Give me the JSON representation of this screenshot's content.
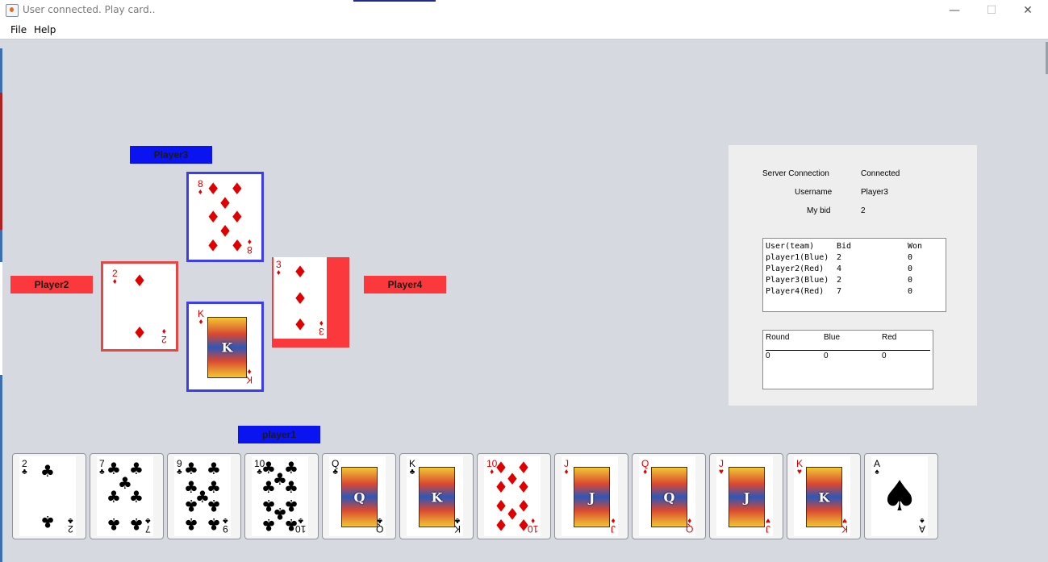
{
  "window": {
    "title": "User connected. Play card..",
    "minimize": "—",
    "maximize": "☐",
    "close": "✕"
  },
  "menu": [
    "File",
    "Help"
  ],
  "players": {
    "top": "Player3",
    "left": "Player2",
    "right": "Player4",
    "bottom": "player1"
  },
  "table_cards": {
    "top": {
      "rank": "8",
      "suit": "♦",
      "color": "red"
    },
    "left": {
      "rank": "2",
      "suit": "♦",
      "color": "red"
    },
    "right": {
      "rank": "3",
      "suit": "♦",
      "color": "red"
    },
    "bottom": {
      "rank": "K",
      "suit": "♦",
      "color": "red"
    }
  },
  "hand": [
    {
      "rank": "2",
      "suit": "♣",
      "color": "black"
    },
    {
      "rank": "7",
      "suit": "♣",
      "color": "black"
    },
    {
      "rank": "9",
      "suit": "♣",
      "color": "black"
    },
    {
      "rank": "10",
      "suit": "♣",
      "color": "black"
    },
    {
      "rank": "Q",
      "suit": "♣",
      "color": "black"
    },
    {
      "rank": "K",
      "suit": "♣",
      "color": "black"
    },
    {
      "rank": "10",
      "suit": "♦",
      "color": "red"
    },
    {
      "rank": "J",
      "suit": "♦",
      "color": "red"
    },
    {
      "rank": "Q",
      "suit": "♦",
      "color": "red"
    },
    {
      "rank": "J",
      "suit": "♥",
      "color": "red"
    },
    {
      "rank": "K",
      "suit": "♥",
      "color": "red"
    },
    {
      "rank": "A",
      "suit": "♠",
      "color": "black"
    }
  ],
  "info": {
    "server_connection_label": "Server Connection",
    "server_connection_value": "Connected",
    "username_label": "Username",
    "username_value": "Player3",
    "my_bid_label": "My bid",
    "my_bid_value": "2"
  },
  "bids_table": {
    "headers": [
      "User(team)",
      "Bid",
      "Won"
    ],
    "rows": [
      [
        "player1(Blue)",
        "2",
        "0"
      ],
      [
        "Player2(Red)",
        "4",
        "0"
      ],
      [
        "Player3(Blue)",
        "2",
        "0"
      ],
      [
        "Player4(Red)",
        "7",
        "0"
      ]
    ]
  },
  "score_table": {
    "headers": [
      "Round",
      "Blue",
      "Red"
    ],
    "rows": [
      [
        "0",
        "0",
        "0"
      ]
    ]
  },
  "colors": {
    "background": "#d6d9e0",
    "blue_team": "#0a14f0",
    "red_team": "#fb383b",
    "panel": "#eeeeee"
  }
}
